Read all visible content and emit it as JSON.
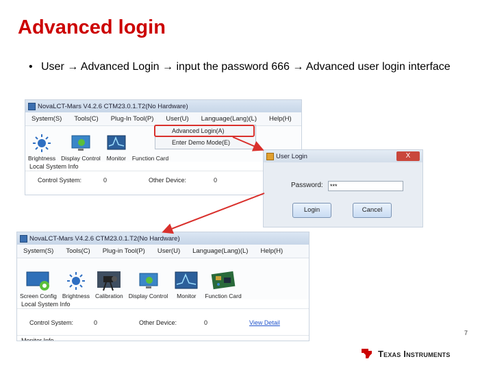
{
  "slide": {
    "title": "Advanced login",
    "bullet_dot": "•",
    "bullet_text": "User → Advanced Login → input the password 666 → Advanced user login interface",
    "page_number": "7",
    "logo_text": "Texas Instruments"
  },
  "win1": {
    "title": "NovaLCT-Mars V4.2.6 CTM23.0.1.T2(No Hardware)",
    "menu": [
      "System(S)",
      "Tools(C)",
      "Plug-In Tool(P)",
      "User(U)",
      "Language(Lang)(L)",
      "Help(H)"
    ],
    "tools": [
      {
        "label": "Brightness",
        "icon": "brightness-icon"
      },
      {
        "label": "Display Control",
        "icon": "display-control-icon"
      },
      {
        "label": "Monitor",
        "icon": "monitor-icon"
      },
      {
        "label": "Function Card",
        "icon": "function-card-icon"
      }
    ],
    "dropdown": [
      "Advanced Login(A)",
      "Enter Demo Mode(E)"
    ],
    "section": "Local System Info",
    "control_system_label": "Control System:",
    "control_system_value": "0",
    "other_device_label": "Other Device:",
    "other_device_value": "0"
  },
  "dialog": {
    "title": "User Login",
    "close": "X",
    "password_label": "Password:",
    "password_value": "***",
    "login_button": "Login",
    "cancel_button": "Cancel"
  },
  "win2": {
    "title": "NovaLCT-Mars V4.2.6 CTM23.0.1.T2(No Hardware)",
    "menu": [
      "System(S)",
      "Tools(C)",
      "Plug-in Tool(P)",
      "User(U)",
      "Language(Lang)(L)",
      "Help(H)"
    ],
    "tools": [
      {
        "label": "Screen Config",
        "icon": "screen-config-icon"
      },
      {
        "label": "Brightness",
        "icon": "brightness-icon"
      },
      {
        "label": "Calibration",
        "icon": "calibration-icon"
      },
      {
        "label": "Display Control",
        "icon": "display-control-icon"
      },
      {
        "label": "Monitor",
        "icon": "monitor-icon"
      },
      {
        "label": "Function Card",
        "icon": "function-card-icon"
      }
    ],
    "section": "Local System Info",
    "control_system_label": "Control System:",
    "control_system_value": "0",
    "other_device_label": "Other Device:",
    "other_device_value": "0",
    "view_detail": "View Detail",
    "footer_section": "Monitor Info"
  },
  "colors": {
    "title_red": "#cc0000",
    "highlight_red": "#d9302c"
  }
}
